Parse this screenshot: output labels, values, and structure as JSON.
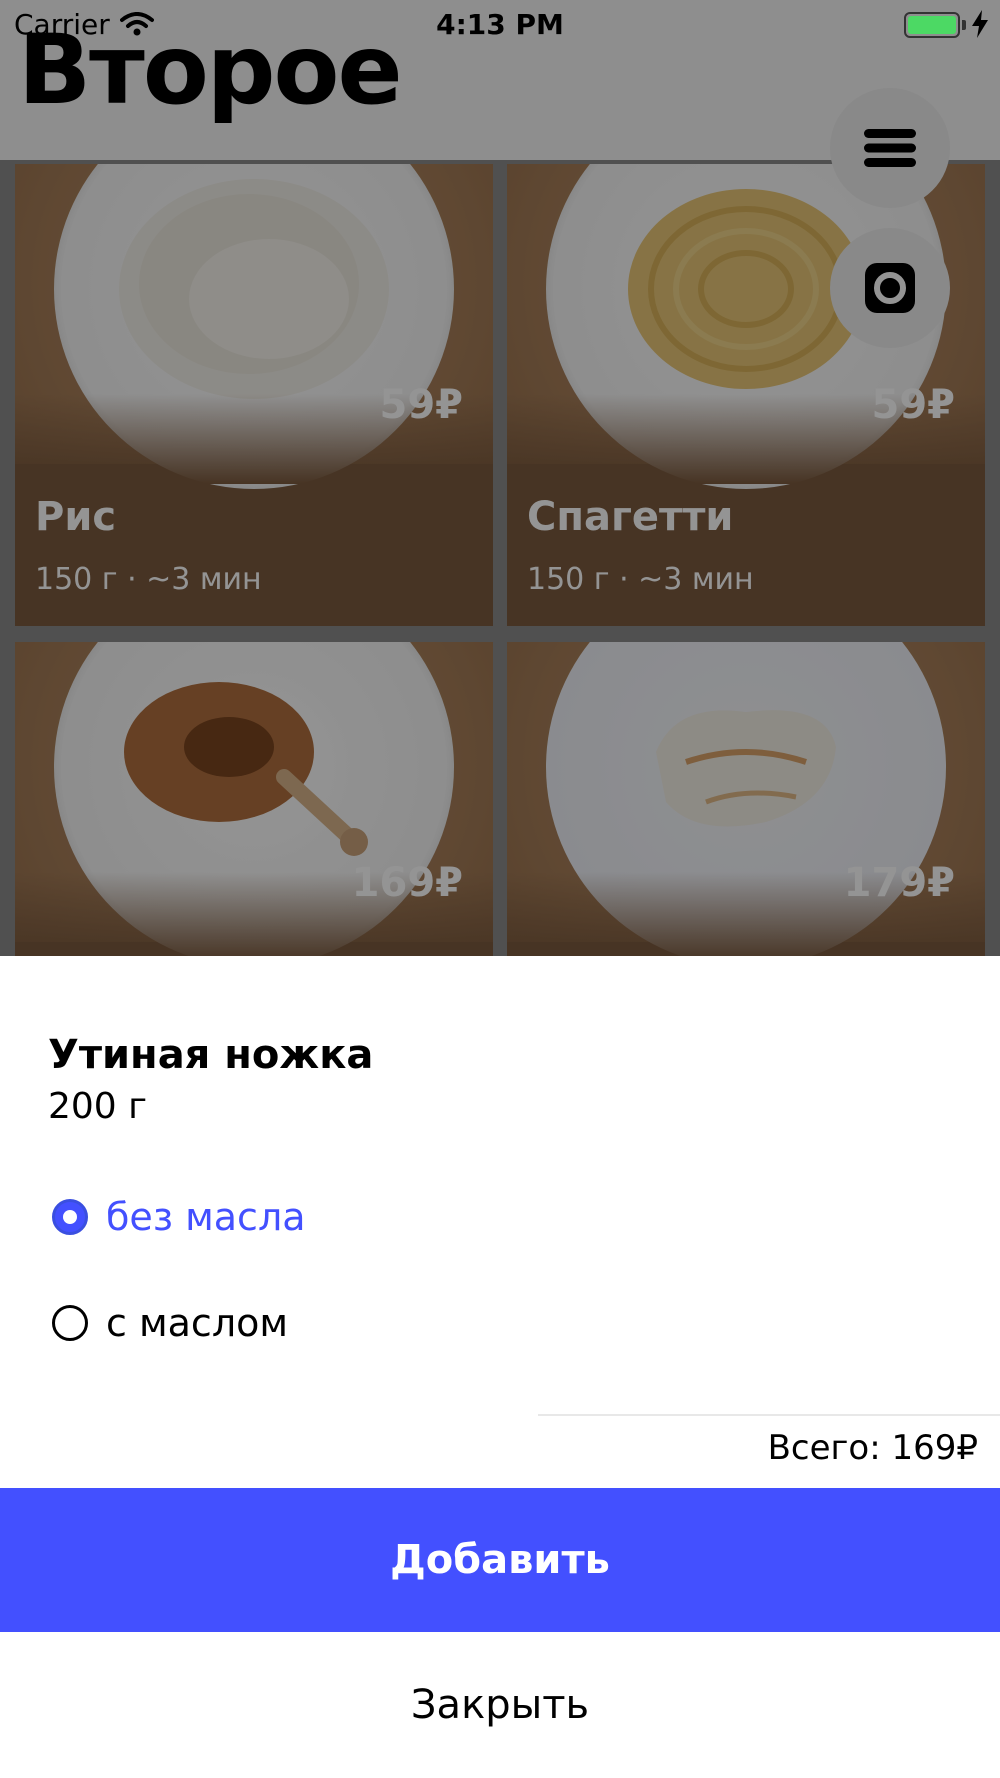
{
  "status_bar": {
    "carrier": "Carrier",
    "time": "4:13 PM"
  },
  "page": {
    "title": "Второе"
  },
  "menu": [
    {
      "name": "Рис",
      "price": "59₽",
      "weight": "150 г",
      "time": "~3 мин",
      "meta": "150 г  ·  ~3 мин",
      "food": "rice"
    },
    {
      "name": "Спагетти",
      "price": "59₽",
      "weight": "150 г",
      "time": "~3 мин",
      "meta": "150 г  ·  ~3 мин",
      "food": "spaghetti"
    },
    {
      "name": "Утиная ножка",
      "price": "169₽",
      "food": "duck-leg"
    },
    {
      "name": "",
      "price": "179₽",
      "food": "fish"
    }
  ],
  "fabs": {
    "menu_icon": "hamburger-menu-icon",
    "camera_icon": "camera-icon"
  },
  "sheet": {
    "item_name": "Утиная ножка",
    "item_weight": "200 г",
    "options": [
      {
        "label": "без масла",
        "selected": true
      },
      {
        "label": "с маслом",
        "selected": false
      }
    ],
    "total": "Всего: 169₽",
    "add_label": "Добавить",
    "close_label": "Закрыть"
  },
  "colors": {
    "accent": "#4350ff",
    "card_brown": "#7b5a3e",
    "battery": "#4cd964"
  }
}
